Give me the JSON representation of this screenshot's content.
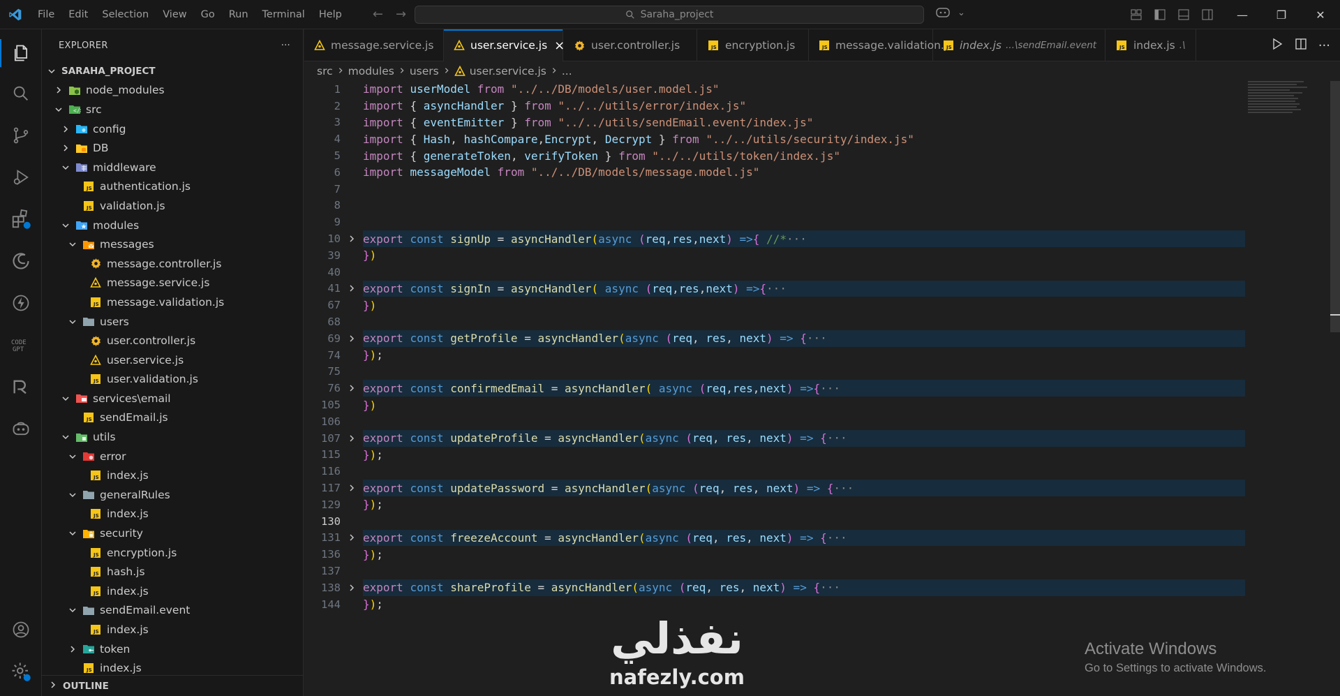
{
  "menu": [
    "File",
    "Edit",
    "Selection",
    "View",
    "Go",
    "Run",
    "Terminal",
    "Help"
  ],
  "search": {
    "text": "Saraha_project"
  },
  "sidebar": {
    "title": "EXPLORER",
    "more": "···",
    "project": "SARAHA_PROJECT",
    "tree": [
      {
        "label": "node_modules",
        "depth": 1,
        "chev": "right",
        "icon": "folder-node"
      },
      {
        "label": "src",
        "depth": 1,
        "chev": "down",
        "icon": "folder-src"
      },
      {
        "label": "config",
        "depth": 2,
        "chev": "right",
        "icon": "folder-config"
      },
      {
        "label": "DB",
        "depth": 2,
        "chev": "right",
        "icon": "folder-db"
      },
      {
        "label": "middleware",
        "depth": 2,
        "chev": "down",
        "icon": "folder-middleware"
      },
      {
        "label": "authentication.js",
        "depth": 3,
        "chev": "none",
        "icon": "js"
      },
      {
        "label": "validation.js",
        "depth": 3,
        "chev": "none",
        "icon": "js"
      },
      {
        "label": "modules",
        "depth": 2,
        "chev": "down",
        "icon": "folder-modules"
      },
      {
        "label": "messages",
        "depth": 3,
        "chev": "down",
        "icon": "folder-messages"
      },
      {
        "label": "message.controller.js",
        "depth": 4,
        "chev": "none",
        "icon": "gear"
      },
      {
        "label": "message.service.js",
        "depth": 4,
        "chev": "none",
        "icon": "service"
      },
      {
        "label": "message.validation.js",
        "depth": 4,
        "chev": "none",
        "icon": "js"
      },
      {
        "label": "users",
        "depth": 3,
        "chev": "down",
        "icon": "folder-users"
      },
      {
        "label": "user.controller.js",
        "depth": 4,
        "chev": "none",
        "icon": "gear"
      },
      {
        "label": "user.service.js",
        "depth": 4,
        "chev": "none",
        "icon": "service"
      },
      {
        "label": "user.validation.js",
        "depth": 4,
        "chev": "none",
        "icon": "js"
      },
      {
        "label": "services\\email",
        "depth": 2,
        "chev": "down",
        "icon": "folder-services"
      },
      {
        "label": "sendEmail.js",
        "depth": 3,
        "chev": "none",
        "icon": "js"
      },
      {
        "label": "utils",
        "depth": 2,
        "chev": "down",
        "icon": "folder-utils"
      },
      {
        "label": "error",
        "depth": 3,
        "chev": "down",
        "icon": "folder-error"
      },
      {
        "label": "index.js",
        "depth": 4,
        "chev": "none",
        "icon": "js"
      },
      {
        "label": "generalRules",
        "depth": 3,
        "chev": "down",
        "icon": "folder-plain"
      },
      {
        "label": "index.js",
        "depth": 4,
        "chev": "none",
        "icon": "js"
      },
      {
        "label": "security",
        "depth": 3,
        "chev": "down",
        "icon": "folder-security"
      },
      {
        "label": "encryption.js",
        "depth": 4,
        "chev": "none",
        "icon": "js"
      },
      {
        "label": "hash.js",
        "depth": 4,
        "chev": "none",
        "icon": "js"
      },
      {
        "label": "index.js",
        "depth": 4,
        "chev": "none",
        "icon": "js"
      },
      {
        "label": "sendEmail.event",
        "depth": 3,
        "chev": "down",
        "icon": "folder-plain"
      },
      {
        "label": "index.js",
        "depth": 4,
        "chev": "none",
        "icon": "js"
      },
      {
        "label": "token",
        "depth": 3,
        "chev": "right",
        "icon": "folder-token"
      },
      {
        "label": "index.js",
        "depth": 3,
        "chev": "none",
        "icon": "js"
      }
    ],
    "outline": "OUTLINE"
  },
  "tabs": [
    {
      "label": "message.service.js",
      "icon": "service",
      "active": false,
      "desc": ""
    },
    {
      "label": "user.service.js",
      "icon": "service",
      "active": true,
      "desc": ""
    },
    {
      "label": "user.controller.js",
      "icon": "gear",
      "active": false,
      "desc": ""
    },
    {
      "label": "encryption.js",
      "icon": "js",
      "active": false,
      "desc": ""
    },
    {
      "label": "message.validation.js",
      "icon": "js",
      "active": false,
      "desc": ""
    },
    {
      "label": "index.js",
      "icon": "js",
      "active": false,
      "desc": "...\\sendEmail.event",
      "italic": true
    },
    {
      "label": "index.js",
      "icon": "js",
      "active": false,
      "desc": ".\\"
    }
  ],
  "breadcrumb": [
    "src",
    "modules",
    "users",
    "user.service.js",
    "..."
  ],
  "code": [
    {
      "n": "1",
      "tokens": [
        [
          "k-import",
          "import "
        ],
        [
          "var",
          "userModel "
        ],
        [
          "k-import",
          "from "
        ],
        [
          "str",
          "\"../../DB/models/user.model.js\""
        ]
      ]
    },
    {
      "n": "2",
      "tokens": [
        [
          "k-import",
          "import "
        ],
        [
          "pun",
          "{ "
        ],
        [
          "var",
          "asyncHandler "
        ],
        [
          "pun",
          "} "
        ],
        [
          "k-import",
          "from "
        ],
        [
          "str",
          "\"../../utils/error/index.js\""
        ]
      ]
    },
    {
      "n": "3",
      "tokens": [
        [
          "k-import",
          "import "
        ],
        [
          "pun",
          "{ "
        ],
        [
          "var",
          "eventEmitter "
        ],
        [
          "pun",
          "} "
        ],
        [
          "k-import",
          "from "
        ],
        [
          "str",
          "\"../../utils/sendEmail.event/index.js\""
        ]
      ]
    },
    {
      "n": "4",
      "tokens": [
        [
          "k-import",
          "import "
        ],
        [
          "pun",
          "{ "
        ],
        [
          "var",
          "Hash"
        ],
        [
          "pun",
          ", "
        ],
        [
          "var",
          "hashCompare"
        ],
        [
          "pun",
          ","
        ],
        [
          "var",
          "Encrypt"
        ],
        [
          "pun",
          ", "
        ],
        [
          "var",
          "Decrypt "
        ],
        [
          "pun",
          "} "
        ],
        [
          "k-import",
          "from "
        ],
        [
          "str",
          "\"../../utils/security/index.js\""
        ]
      ]
    },
    {
      "n": "5",
      "tokens": [
        [
          "k-import",
          "import "
        ],
        [
          "pun",
          "{ "
        ],
        [
          "var",
          "generateToken"
        ],
        [
          "pun",
          ", "
        ],
        [
          "var",
          "verifyToken "
        ],
        [
          "pun",
          "} "
        ],
        [
          "k-import",
          "from "
        ],
        [
          "str",
          "\"../../utils/token/index.js\""
        ]
      ]
    },
    {
      "n": "6",
      "tokens": [
        [
          "k-import",
          "import "
        ],
        [
          "var",
          "messageModel "
        ],
        [
          "k-import",
          "from "
        ],
        [
          "str",
          "\"../../DB/models/message.model.js\""
        ]
      ]
    },
    {
      "n": "7",
      "tokens": []
    },
    {
      "n": "8",
      "tokens": []
    },
    {
      "n": "9",
      "tokens": []
    },
    {
      "n": "10",
      "folded": true,
      "tokens": [
        [
          "k-import",
          "export "
        ],
        [
          "k-blue",
          "const "
        ],
        [
          "fn",
          "signUp "
        ],
        [
          "pun",
          "= "
        ],
        [
          "fn",
          "asyncHandler"
        ],
        [
          "bracket",
          "("
        ],
        [
          "k-blue",
          "async "
        ],
        [
          "bracket2",
          "("
        ],
        [
          "var",
          "req"
        ],
        [
          "pun",
          ","
        ],
        [
          "var",
          "res"
        ],
        [
          "pun",
          ","
        ],
        [
          "var",
          "next"
        ],
        [
          "bracket2",
          ")"
        ],
        [
          "k-blue",
          " =>"
        ],
        [
          "bracket2",
          "{ "
        ],
        [
          "cmt",
          "//*"
        ],
        [
          "ell",
          "···"
        ]
      ]
    },
    {
      "n": "39",
      "tokens": [
        [
          "bracket2",
          "}"
        ],
        [
          "bracket",
          ")"
        ]
      ]
    },
    {
      "n": "40",
      "tokens": []
    },
    {
      "n": "41",
      "folded": true,
      "tokens": [
        [
          "k-import",
          "export "
        ],
        [
          "k-blue",
          "const "
        ],
        [
          "fn",
          "signIn "
        ],
        [
          "pun",
          "= "
        ],
        [
          "fn",
          "asyncHandler"
        ],
        [
          "bracket",
          "( "
        ],
        [
          "k-blue",
          "async "
        ],
        [
          "bracket2",
          "("
        ],
        [
          "var",
          "req"
        ],
        [
          "pun",
          ","
        ],
        [
          "var",
          "res"
        ],
        [
          "pun",
          ","
        ],
        [
          "var",
          "next"
        ],
        [
          "bracket2",
          ")"
        ],
        [
          "k-blue",
          " =>"
        ],
        [
          "bracket2",
          "{"
        ],
        [
          "ell",
          "···"
        ]
      ]
    },
    {
      "n": "67",
      "tokens": [
        [
          "bracket2",
          "}"
        ],
        [
          "bracket",
          ")"
        ]
      ]
    },
    {
      "n": "68",
      "tokens": []
    },
    {
      "n": "69",
      "folded": true,
      "tokens": [
        [
          "k-import",
          "export "
        ],
        [
          "k-blue",
          "const "
        ],
        [
          "fn",
          "getProfile "
        ],
        [
          "pun",
          "= "
        ],
        [
          "fn",
          "asyncHandler"
        ],
        [
          "bracket",
          "("
        ],
        [
          "k-blue",
          "async "
        ],
        [
          "bracket2",
          "("
        ],
        [
          "var",
          "req"
        ],
        [
          "pun",
          ", "
        ],
        [
          "var",
          "res"
        ],
        [
          "pun",
          ", "
        ],
        [
          "var",
          "next"
        ],
        [
          "bracket2",
          ")"
        ],
        [
          "k-blue",
          " => "
        ],
        [
          "bracket2",
          "{"
        ],
        [
          "ell",
          "···"
        ]
      ]
    },
    {
      "n": "74",
      "tokens": [
        [
          "bracket2",
          "}"
        ],
        [
          "bracket",
          ")"
        ],
        [
          "pun",
          ";"
        ]
      ]
    },
    {
      "n": "75",
      "tokens": []
    },
    {
      "n": "76",
      "folded": true,
      "tokens": [
        [
          "k-import",
          "export "
        ],
        [
          "k-blue",
          "const "
        ],
        [
          "fn",
          "confirmedEmail "
        ],
        [
          "pun",
          "= "
        ],
        [
          "fn",
          "asyncHandler"
        ],
        [
          "bracket",
          "( "
        ],
        [
          "k-blue",
          "async "
        ],
        [
          "bracket2",
          "("
        ],
        [
          "var",
          "req"
        ],
        [
          "pun",
          ","
        ],
        [
          "var",
          "res"
        ],
        [
          "pun",
          ","
        ],
        [
          "var",
          "next"
        ],
        [
          "bracket2",
          ")"
        ],
        [
          "k-blue",
          " =>"
        ],
        [
          "bracket2",
          "{"
        ],
        [
          "ell",
          "···"
        ]
      ]
    },
    {
      "n": "105",
      "tokens": [
        [
          "bracket2",
          "}"
        ],
        [
          "bracket",
          ")"
        ]
      ]
    },
    {
      "n": "106",
      "tokens": []
    },
    {
      "n": "107",
      "folded": true,
      "tokens": [
        [
          "k-import",
          "export "
        ],
        [
          "k-blue",
          "const "
        ],
        [
          "fn",
          "updateProfile "
        ],
        [
          "pun",
          "= "
        ],
        [
          "fn",
          "asyncHandler"
        ],
        [
          "bracket",
          "("
        ],
        [
          "k-blue",
          "async "
        ],
        [
          "bracket2",
          "("
        ],
        [
          "var",
          "req"
        ],
        [
          "pun",
          ", "
        ],
        [
          "var",
          "res"
        ],
        [
          "pun",
          ", "
        ],
        [
          "var",
          "next"
        ],
        [
          "bracket2",
          ")"
        ],
        [
          "k-blue",
          " => "
        ],
        [
          "bracket2",
          "{"
        ],
        [
          "ell",
          "···"
        ]
      ]
    },
    {
      "n": "115",
      "tokens": [
        [
          "bracket2",
          "}"
        ],
        [
          "bracket",
          ")"
        ],
        [
          "pun",
          ";"
        ]
      ]
    },
    {
      "n": "116",
      "tokens": []
    },
    {
      "n": "117",
      "folded": true,
      "tokens": [
        [
          "k-import",
          "export "
        ],
        [
          "k-blue",
          "const "
        ],
        [
          "fn",
          "updatePassword "
        ],
        [
          "pun",
          "= "
        ],
        [
          "fn",
          "asyncHandler"
        ],
        [
          "bracket",
          "("
        ],
        [
          "k-blue",
          "async "
        ],
        [
          "bracket2",
          "("
        ],
        [
          "var",
          "req"
        ],
        [
          "pun",
          ", "
        ],
        [
          "var",
          "res"
        ],
        [
          "pun",
          ", "
        ],
        [
          "var",
          "next"
        ],
        [
          "bracket2",
          ")"
        ],
        [
          "k-blue",
          " => "
        ],
        [
          "bracket2",
          "{"
        ],
        [
          "ell",
          "···"
        ]
      ]
    },
    {
      "n": "129",
      "tokens": [
        [
          "bracket2",
          "}"
        ],
        [
          "bracket",
          ")"
        ],
        [
          "pun",
          ";"
        ]
      ]
    },
    {
      "n": "130",
      "current": true,
      "tokens": []
    },
    {
      "n": "131",
      "folded": true,
      "tokens": [
        [
          "k-import",
          "export "
        ],
        [
          "k-blue",
          "const "
        ],
        [
          "fn",
          "freezeAccount "
        ],
        [
          "pun",
          "= "
        ],
        [
          "fn",
          "asyncHandler"
        ],
        [
          "bracket",
          "("
        ],
        [
          "k-blue",
          "async "
        ],
        [
          "bracket2",
          "("
        ],
        [
          "var",
          "req"
        ],
        [
          "pun",
          ", "
        ],
        [
          "var",
          "res"
        ],
        [
          "pun",
          ", "
        ],
        [
          "var",
          "next"
        ],
        [
          "bracket2",
          ")"
        ],
        [
          "k-blue",
          " => "
        ],
        [
          "bracket2",
          "{"
        ],
        [
          "ell",
          "···"
        ]
      ]
    },
    {
      "n": "136",
      "tokens": [
        [
          "bracket2",
          "}"
        ],
        [
          "bracket",
          ")"
        ],
        [
          "pun",
          ";"
        ]
      ]
    },
    {
      "n": "137",
      "tokens": []
    },
    {
      "n": "138",
      "folded": true,
      "tokens": [
        [
          "k-import",
          "export "
        ],
        [
          "k-blue",
          "const "
        ],
        [
          "fn",
          "shareProfile "
        ],
        [
          "pun",
          "= "
        ],
        [
          "fn",
          "asyncHandler"
        ],
        [
          "bracket",
          "("
        ],
        [
          "k-blue",
          "async "
        ],
        [
          "bracket2",
          "("
        ],
        [
          "var",
          "req"
        ],
        [
          "pun",
          ", "
        ],
        [
          "var",
          "res"
        ],
        [
          "pun",
          ", "
        ],
        [
          "var",
          "next"
        ],
        [
          "bracket2",
          ")"
        ],
        [
          "k-blue",
          " => "
        ],
        [
          "bracket2",
          "{"
        ],
        [
          "ell",
          "···"
        ]
      ]
    },
    {
      "n": "144",
      "tokens": [
        [
          "bracket2",
          "}"
        ],
        [
          "bracket",
          ")"
        ],
        [
          "pun",
          ";"
        ]
      ]
    }
  ],
  "watermark": {
    "arabic": "نفذلي",
    "latin": "nafezly.com"
  },
  "activation": {
    "title": "Activate Windows",
    "subtitle": "Go to Settings to activate Windows."
  },
  "colors": {
    "accent": "#0078d4",
    "background": "#1f1f1f",
    "sidebar": "#181818",
    "js_icon": "#f5c518"
  }
}
